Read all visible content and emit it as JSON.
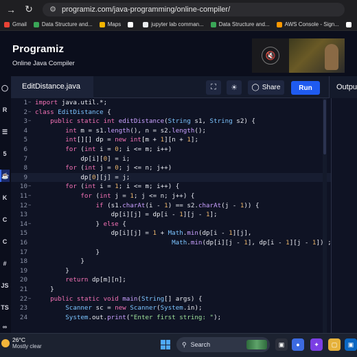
{
  "browser": {
    "url": "programiz.com/java-programming/online-compiler/",
    "bookmarks": [
      {
        "label": "Gmail",
        "color": "#ea4335"
      },
      {
        "label": "Data Structure and...",
        "color": "#3aa657"
      },
      {
        "label": "Maps",
        "color": "#f4b400"
      },
      {
        "label": "",
        "color": "#ffffff"
      },
      {
        "label": "jupyter lab comman...",
        "color": "#e8eaed"
      },
      {
        "label": "Data Structure and...",
        "color": "#3aa657"
      },
      {
        "label": "AWS Console - Sign...",
        "color": "#ff9900"
      },
      {
        "label": "",
        "color": "#ffffff"
      }
    ]
  },
  "site": {
    "logo": "Programiz",
    "subtitle": "Online Java Compiler"
  },
  "toolbar": {
    "file_name": "EditDistance.java",
    "share_label": "Share",
    "run_label": "Run",
    "output_label": "Output"
  },
  "editor": {
    "current_line": 9,
    "lines": [
      {
        "n": "1",
        "fold": "−",
        "html": "<span class='kw'>import</span> java.util.*;"
      },
      {
        "n": "2",
        "fold": "−",
        "html": "<span class='kw'>class</span> <span class='ty'>EditDistance</span> {"
      },
      {
        "n": "3",
        "fold": "−",
        "html": "    <span class='kw'>public static int</span> <span class='fn'>editDistance</span>(<span class='ty'>String</span> s1, <span class='ty'>String</span> s2) {"
      },
      {
        "n": "4",
        "fold": "",
        "html": "        <span class='kw'>int</span> m = s1.<span class='fn'>length</span>(), n = s2.<span class='fn'>length</span>();"
      },
      {
        "n": "5",
        "fold": "",
        "html": "        <span class='kw'>int</span>[][] dp = <span class='kw'>new int</span>[m + <span class='num'>1</span>][n + <span class='num'>1</span>];"
      },
      {
        "n": "6",
        "fold": "",
        "html": "        <span class='kw'>for</span> (<span class='kw'>int</span> i = <span class='num'>0</span>; i &lt;= m; i++)"
      },
      {
        "n": "7",
        "fold": "",
        "html": "            dp[i][<span class='num'>0</span>] = i;"
      },
      {
        "n": "8",
        "fold": "",
        "html": "        <span class='kw'>for</span> (<span class='kw'>int</span> j = <span class='num'>0</span>; j &lt;= n; j++)"
      },
      {
        "n": "9",
        "fold": "",
        "html": "            dp[<span class='num'>0</span>][j] = j;"
      },
      {
        "n": "10",
        "fold": "−",
        "html": "        <span class='kw'>for</span> (<span class='kw'>int</span> i = <span class='num'>1</span>; i &lt;= m; i++) {"
      },
      {
        "n": "11",
        "fold": "−",
        "html": "            <span class='kw'>for</span> (<span class='kw'>int</span> j = <span class='num'>1</span>; j &lt;= n; j++) {"
      },
      {
        "n": "12",
        "fold": "−",
        "html": "                <span class='kw'>if</span> (s1.<span class='fn'>charAt</span>(i - <span class='num'>1</span>) == s2.<span class='fn'>charAt</span>(j - <span class='num'>1</span>)) {"
      },
      {
        "n": "13",
        "fold": "",
        "html": "                    dp[i][j] = dp[i - <span class='num'>1</span>][j - <span class='num'>1</span>];"
      },
      {
        "n": "14",
        "fold": "−",
        "html": "                } <span class='kw'>else</span> {"
      },
      {
        "n": "15",
        "fold": "",
        "html": "                    dp[i][j] = <span class='num'>1</span> + <span class='ty'>Math</span>.<span class='fn'>min</span>(dp[i - <span class='num'>1</span>][j],"
      },
      {
        "n": "16",
        "fold": "",
        "html": "                                    <span class='ty'>Math</span>.<span class='fn'>min</span>(dp[i][j - <span class='num'>1</span>], dp[i - <span class='num'>1</span>][j - <span class='num'>1</span>]));"
      },
      {
        "n": "17",
        "fold": "",
        "html": "                }"
      },
      {
        "n": "18",
        "fold": "",
        "html": "            }"
      },
      {
        "n": "19",
        "fold": "",
        "html": "        }"
      },
      {
        "n": "20",
        "fold": "",
        "html": "        <span class='kw'>return</span> dp[m][n];"
      },
      {
        "n": "21",
        "fold": "",
        "html": "    }"
      },
      {
        "n": "22",
        "fold": "−",
        "html": "    <span class='kw'>public static void</span> <span class='fn'>main</span>(<span class='ty'>String</span>[] args) {"
      },
      {
        "n": "23",
        "fold": "",
        "html": "        <span class='ty'>Scanner</span> sc = <span class='kw'>new</span> <span class='ty'>Scanner</span>(<span class='ty'>System</span>.in);"
      },
      {
        "n": "24",
        "fold": "",
        "html": "        <span class='ty'>System</span>.out.<span class='fn'>print</span>(<span class='str'>\"Enter first string: \"</span>);"
      }
    ]
  },
  "taskbar": {
    "temperature": "26°C",
    "weather": "Mostly clear",
    "search_placeholder": "Search"
  }
}
